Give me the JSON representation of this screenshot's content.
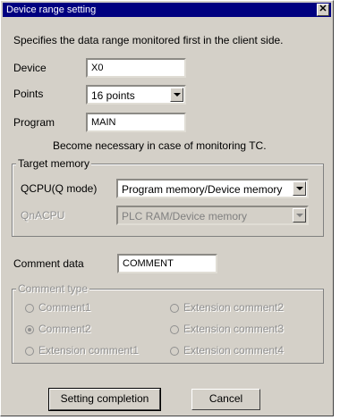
{
  "window": {
    "title": "Device range setting",
    "close_glyph": "✕"
  },
  "description": "Specifies the data range monitored first in the client side.",
  "device": {
    "label": "Device",
    "value": "X0"
  },
  "points": {
    "label": "Points",
    "value": "16 points"
  },
  "program": {
    "label": "Program",
    "value": "MAIN"
  },
  "note": "Become necessary in case of monitoring TC.",
  "target_memory": {
    "legend": "Target memory",
    "qcpu_label": "QCPU(Q mode)",
    "qcpu_value": "Program memory/Device memory",
    "qnacpu_label": "QnACPU",
    "qnacpu_value": "PLC RAM/Device memory"
  },
  "comment_data": {
    "label": "Comment data",
    "value": "COMMENT"
  },
  "comment_type": {
    "legend": "Comment type",
    "options": [
      {
        "label": "Comment1",
        "checked": false
      },
      {
        "label": "Comment2",
        "checked": true
      },
      {
        "label": "Extension comment1",
        "checked": false
      },
      {
        "label": "Extension comment2",
        "checked": false
      },
      {
        "label": "Extension comment3",
        "checked": false
      },
      {
        "label": "Extension comment4",
        "checked": false
      }
    ]
  },
  "buttons": {
    "ok": "Setting completion",
    "cancel": "Cancel"
  }
}
